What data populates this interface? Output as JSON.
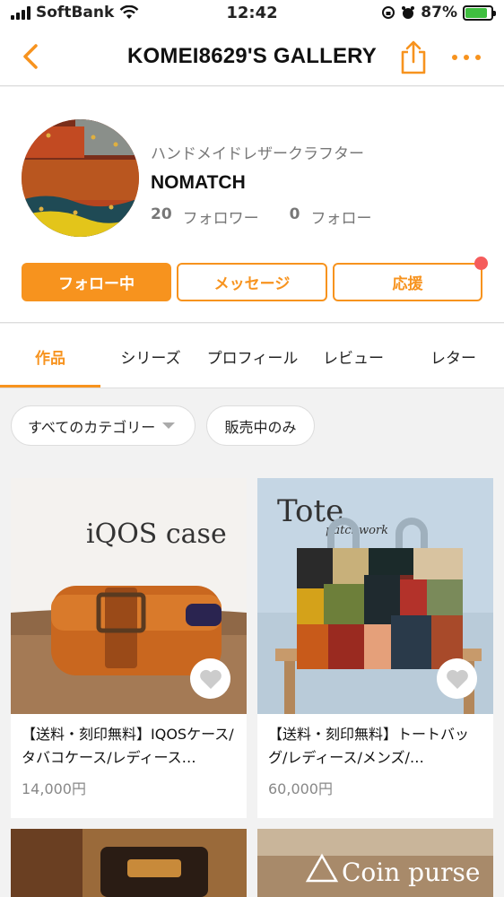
{
  "status_bar": {
    "carrier": "SoftBank",
    "time": "12:42",
    "battery": "87%",
    "battery_level": 0.87
  },
  "nav": {
    "title": "KOMEI8629'S GALLERY"
  },
  "profile": {
    "subtitle": "ハンドメイドレザークラフター",
    "name": "NOMATCH",
    "followers_count": "20",
    "followers_label": "フォロワー",
    "following_count": "0",
    "following_label": "フォロー",
    "buttons": {
      "follow": "フォロー中",
      "message": "メッセージ",
      "support": "応援"
    }
  },
  "tabs": [
    {
      "label": "作品"
    },
    {
      "label": "シリーズ"
    },
    {
      "label": "プロフィール"
    },
    {
      "label": "レビュー"
    },
    {
      "label": "レター"
    }
  ],
  "filters": {
    "category": "すべてのカテゴリー",
    "on_sale": "販売中のみ"
  },
  "products": [
    {
      "image_text": "iQOS case",
      "title": "【送料・刻印無料】IQOSケース/タバコケース/レディース…",
      "price": "14,000円"
    },
    {
      "image_text": "Tote",
      "image_subtext": "patchwork",
      "title": "【送料・刻印無料】トートバッグ/レディース/メンズ/…",
      "price": "60,000円"
    },
    {
      "image_text": ""
    },
    {
      "image_text": "Coin purse"
    }
  ],
  "colors": {
    "accent": "#f7931e",
    "badge": "#f55c5c"
  }
}
